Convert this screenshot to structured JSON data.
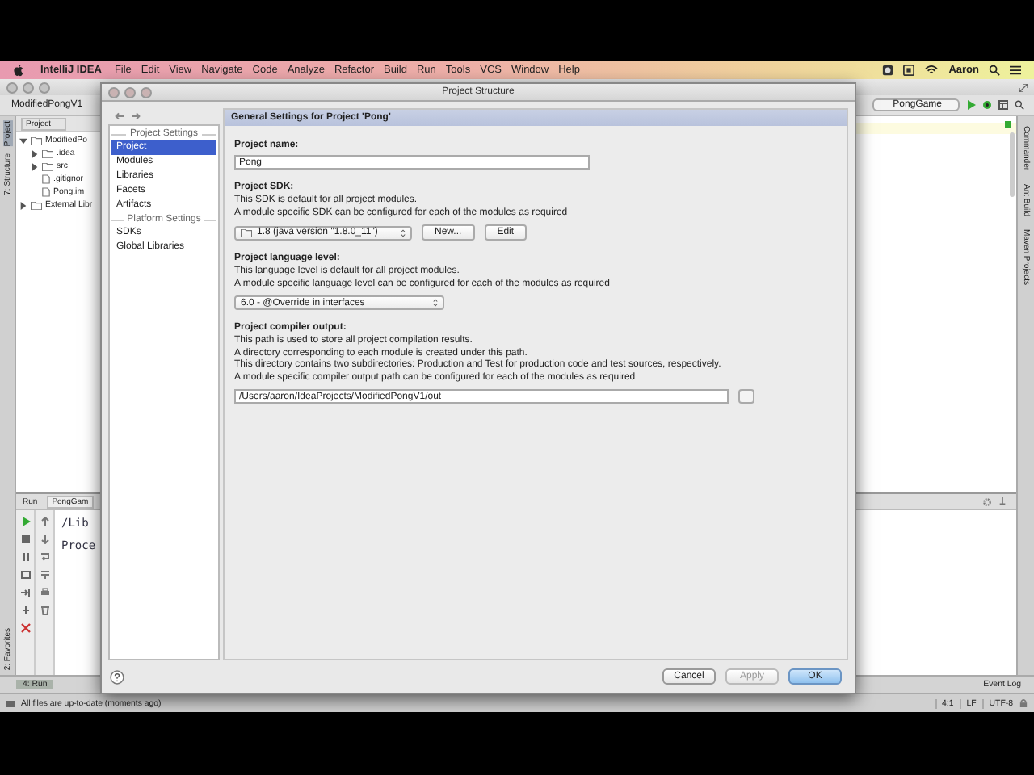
{
  "menubar": {
    "app": "IntelliJ IDEA",
    "menus": [
      "File",
      "Edit",
      "View",
      "Navigate",
      "Code",
      "Analyze",
      "Refactor",
      "Build",
      "Run",
      "Tools",
      "VCS",
      "Window",
      "Help"
    ],
    "user": "Aaron"
  },
  "ide": {
    "breadcrumb": "ModifiedPongV1",
    "run_config": "PongGame",
    "project_tab": "Project",
    "left_tabs": [
      {
        "label": "Project",
        "selected": true
      },
      {
        "label": "7: Structure",
        "selected": false
      },
      {
        "label": "2: Favorites",
        "selected": false
      }
    ],
    "tree": [
      {
        "kind": "folder",
        "label": "ModifiedPo",
        "expanded": true,
        "children": [
          {
            "kind": "folder",
            "label": ".idea",
            "expanded": false
          },
          {
            "kind": "folder",
            "label": "src",
            "expanded": false
          },
          {
            "kind": "file",
            "label": ".gitignor"
          },
          {
            "kind": "file",
            "label": "Pong.im"
          }
        ]
      },
      {
        "kind": "folder",
        "label": "External Libr",
        "expanded": false
      }
    ],
    "right_tabs": [
      "Commander",
      "Ant Build",
      "Maven Projects"
    ],
    "run_panel": {
      "tabs": [
        "Run",
        "PongGam"
      ],
      "console": [
        "/Lib",
        "Proce"
      ]
    },
    "bottom_tabs": [
      "4: Run"
    ],
    "status": "All files are up-to-date (moments ago)",
    "event_log": "Event Log",
    "position": "4:1",
    "line_separator": "LF",
    "encoding": "UTF-8"
  },
  "dialog": {
    "title": "Project Structure",
    "header": "General Settings for Project 'Pong'",
    "nav": [
      {
        "title": "Project Settings",
        "items": [
          {
            "label": "Project",
            "selected": true
          },
          {
            "label": "Modules",
            "selected": false
          },
          {
            "label": "Libraries",
            "selected": false
          },
          {
            "label": "Facets",
            "selected": false
          },
          {
            "label": "Artifacts",
            "selected": false
          }
        ]
      },
      {
        "title": "Platform Settings",
        "items": [
          {
            "label": "SDKs",
            "selected": false
          },
          {
            "label": "Global Libraries",
            "selected": false
          }
        ]
      }
    ],
    "name_label": "Project name:",
    "name_value": "Pong",
    "sdk_label": "Project SDK:",
    "sdk_desc": [
      "This SDK is default for all project modules.",
      "A module specific SDK can be configured for each of the modules as required"
    ],
    "sdk_value": "1.8 (java version \"1.8.0_11\")",
    "sdk_buttons": [
      "New...",
      "Edit"
    ],
    "level_label": "Project language level:",
    "level_desc": [
      "This language level is default for all project modules.",
      "A module specific language level can be configured for each of the modules as required"
    ],
    "level_value": "6.0 - @Override in interfaces",
    "output_label": "Project compiler output:",
    "output_desc": [
      "This path is used to store all project compilation results.",
      "A directory corresponding to each module is created under this path.",
      "This directory contains two subdirectories: Production and Test for production code and test sources, respectively.",
      "A module specific compiler output path can be configured for each of the modules as required"
    ],
    "output_value": "/Users/aaron/IdeaProjects/ModifiedPongV1/out",
    "buttons": [
      {
        "label": "Cancel",
        "disabled": false,
        "default": false
      },
      {
        "label": "Apply",
        "disabled": true,
        "default": false
      },
      {
        "label": "OK",
        "disabled": false,
        "default": true
      }
    ]
  }
}
